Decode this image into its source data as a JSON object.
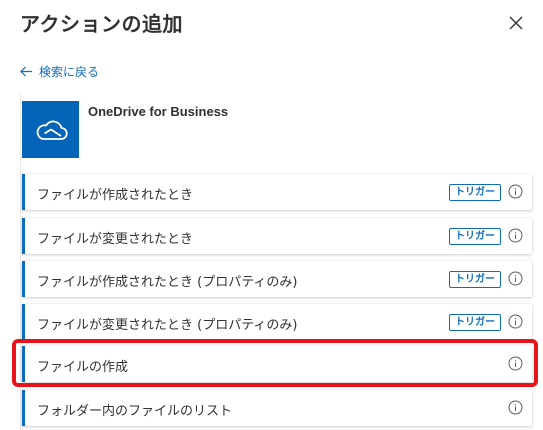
{
  "panel": {
    "title": "アクションの追加",
    "close_icon": "close-icon"
  },
  "back_link": {
    "label": "検索に戻る",
    "icon": "arrow-left-icon"
  },
  "connector": {
    "name": "OneDrive for Business",
    "icon": "onedrive-cloud-icon",
    "color": "#0364b8"
  },
  "actions": [
    {
      "label": "ファイルが作成されたとき",
      "badge": "トリガー",
      "info_icon": "info-icon"
    },
    {
      "label": "ファイルが変更されたとき",
      "badge": "トリガー",
      "info_icon": "info-icon"
    },
    {
      "label": "ファイルが作成されたとき (プロパティのみ)",
      "badge": "トリガー",
      "info_icon": "info-icon"
    },
    {
      "label": "ファイルが変更されたとき (プロパティのみ)",
      "badge": "トリガー",
      "info_icon": "info-icon"
    },
    {
      "label": "ファイルの作成",
      "badge": null,
      "info_icon": "info-icon",
      "highlighted": true
    },
    {
      "label": "フォルダー内のファイルのリスト",
      "badge": null,
      "info_icon": "info-icon"
    }
  ],
  "colors": {
    "accent": "#0f6cbd",
    "highlight": "#e8141b",
    "text": "#323130"
  }
}
